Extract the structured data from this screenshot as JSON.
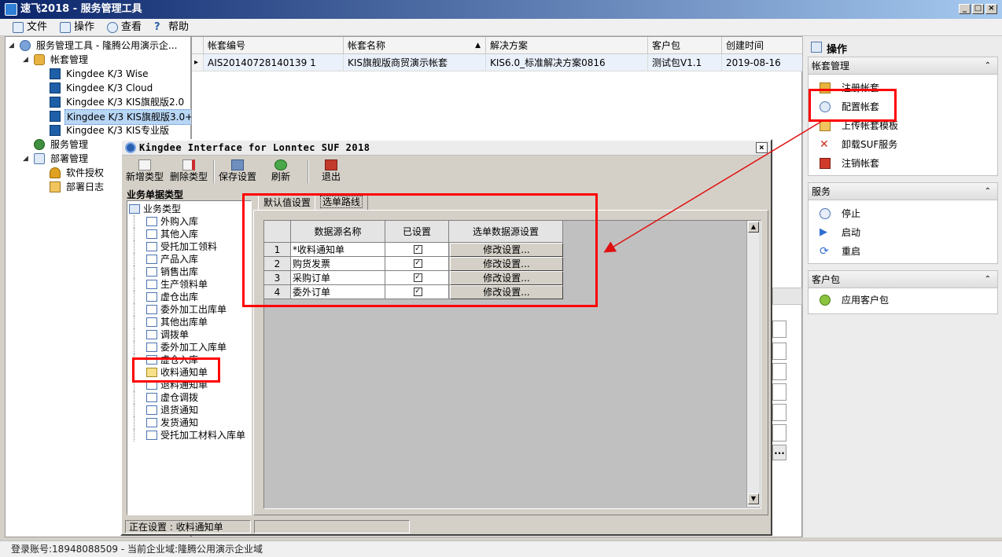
{
  "window": {
    "title": "速飞2018 - 服务管理工具",
    "min": "_",
    "max": "□",
    "close": "×"
  },
  "menu": [
    "文件",
    "操作",
    "查看",
    "帮助"
  ],
  "tree": {
    "root": "服务管理工具 - 隆腾公用演示企...",
    "accounts": "帐套管理",
    "products": [
      "Kingdee K/3 Wise",
      "Kingdee K/3 Cloud",
      "Kingdee K/3 KIS旗舰版2.0",
      "Kingdee K/3 KIS旗舰版3.0+",
      "Kingdee K/3 KIS专业版"
    ],
    "services": "服务管理",
    "deploy": "部署管理",
    "license": "软件授权",
    "deploy_log": "部署日志"
  },
  "grid": {
    "columns": [
      "帐套编号",
      "帐套名称",
      "解决方案",
      "客户包",
      "创建时间"
    ],
    "sort_indicator": "▲",
    "row_marker": "▸",
    "rows": [
      [
        "AIS20140728140139 1",
        "KIS旗舰版商贸演示帐套",
        "KIS6.0_标准解决方案0816",
        "测试包V1.1",
        "2019-08-16"
      ]
    ]
  },
  "right_panel": {
    "title": "操作",
    "sections": [
      {
        "title": "帐套管理",
        "items": [
          "注册帐套",
          "配置帐套",
          "上传帐套模板",
          "卸载SUF服务",
          "注销帐套"
        ]
      },
      {
        "title": "服务",
        "items": [
          "停止",
          "启动",
          "重启"
        ]
      },
      {
        "title": "客户包",
        "items": [
          "应用客户包"
        ]
      }
    ],
    "collapse_glyph": "⌃"
  },
  "dialog": {
    "title": "Kingdee Interface for Lonntec SUF 2018",
    "close": "×",
    "toolbar": [
      "新增类型",
      "删除类型",
      "保存设置",
      "刷新",
      "退出"
    ],
    "type_label": "业务单据类型",
    "type_root": "业务类型",
    "types": [
      "外购入库",
      "其他入库",
      "受托加工领料",
      "产品入库",
      "销售出库",
      "生产领料单",
      "虚仓出库",
      "委外加工出库单",
      "其他出库单",
      "调拨单",
      "委外加工入库单",
      "虚仓入库",
      "收料通知单",
      "退料通知单",
      "虚仓调拨",
      "退货通知",
      "发货通知",
      "受托加工材料入库单"
    ],
    "tabs": [
      "默认值设置",
      "选单路线"
    ],
    "inner_columns": [
      "数据源名称",
      "已设置",
      "选单数据源设置"
    ],
    "inner_rows": [
      {
        "no": "1",
        "name": "*收料通知单",
        "checked": "✓",
        "action": "修改设置..."
      },
      {
        "no": "2",
        "name": "购货发票",
        "checked": "✓",
        "action": "修改设置..."
      },
      {
        "no": "3",
        "name": "采购订单",
        "checked": "✓",
        "action": "修改设置..."
      },
      {
        "no": "4",
        "name": "委外订单",
        "checked": "✓",
        "action": "修改设置..."
      }
    ],
    "status": "正在设置 : 收料通知单",
    "scroll_up": "▲",
    "scroll_down": "▼"
  },
  "behind": {
    "ellipsis": "..."
  },
  "statusbar": "登录账号:18948088509 - 当前企业域:隆腾公用演示企业域",
  "colors": {
    "highlight": "#ff0000",
    "title_start": "#0a246a",
    "title_end": "#a6caf0"
  }
}
